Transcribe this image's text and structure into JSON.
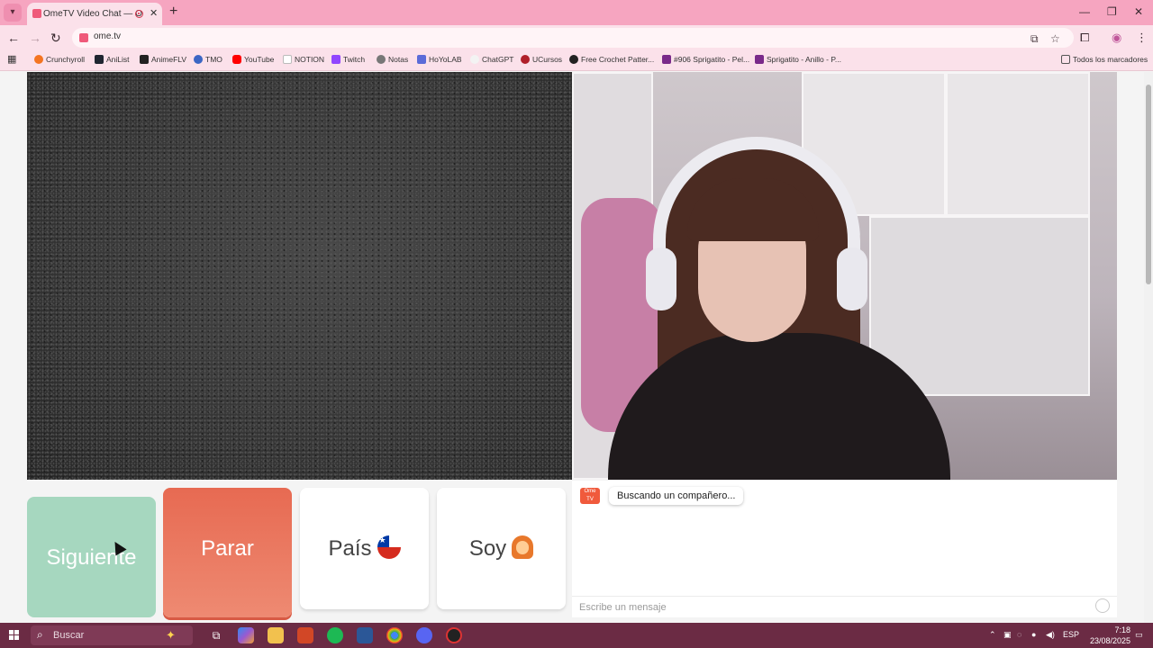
{
  "browser": {
    "tab_title": "OmeTV Video Chat — Ome",
    "url": "ome.tv",
    "bookmarks": [
      {
        "label": "Crunchyroll",
        "color": "#f47521"
      },
      {
        "label": "AniList",
        "color": "#1f2631"
      },
      {
        "label": "AnimeFLV",
        "color": "#222222"
      },
      {
        "label": "TMO",
        "color": "#3b66c4"
      },
      {
        "label": "YouTube",
        "color": "#ff0000"
      },
      {
        "label": "NOTION",
        "color": "#dddddd"
      },
      {
        "label": "Twitch",
        "color": "#9146ff"
      },
      {
        "label": "Notas",
        "color": "#777777"
      },
      {
        "label": "HoYoLAB",
        "color": "#5b6bd8"
      },
      {
        "label": "ChatGPT",
        "color": "#eeeeee"
      },
      {
        "label": "UCursos",
        "color": "#b0202a"
      },
      {
        "label": "Free Crochet Patter...",
        "color": "#222222"
      },
      {
        "label": "#906 Sprigatito - Pel...",
        "color": "#7a2a8a"
      },
      {
        "label": "Sprigatito - Anillo - P...",
        "color": "#7a2a8a"
      }
    ],
    "all_bookmarks_label": "Todos los marcadores"
  },
  "controls": {
    "next_label": "Siguiente",
    "stop_label": "Parar",
    "country_label": "País",
    "gender_label": "Soy"
  },
  "chat": {
    "logo_text": "Ome TV",
    "status_message": "Buscando un compañero...",
    "input_placeholder": "Escribe un mensaje"
  },
  "taskbar": {
    "search_placeholder": "Buscar",
    "language": "ESP",
    "time": "7:18",
    "date": "23/08/2025"
  }
}
